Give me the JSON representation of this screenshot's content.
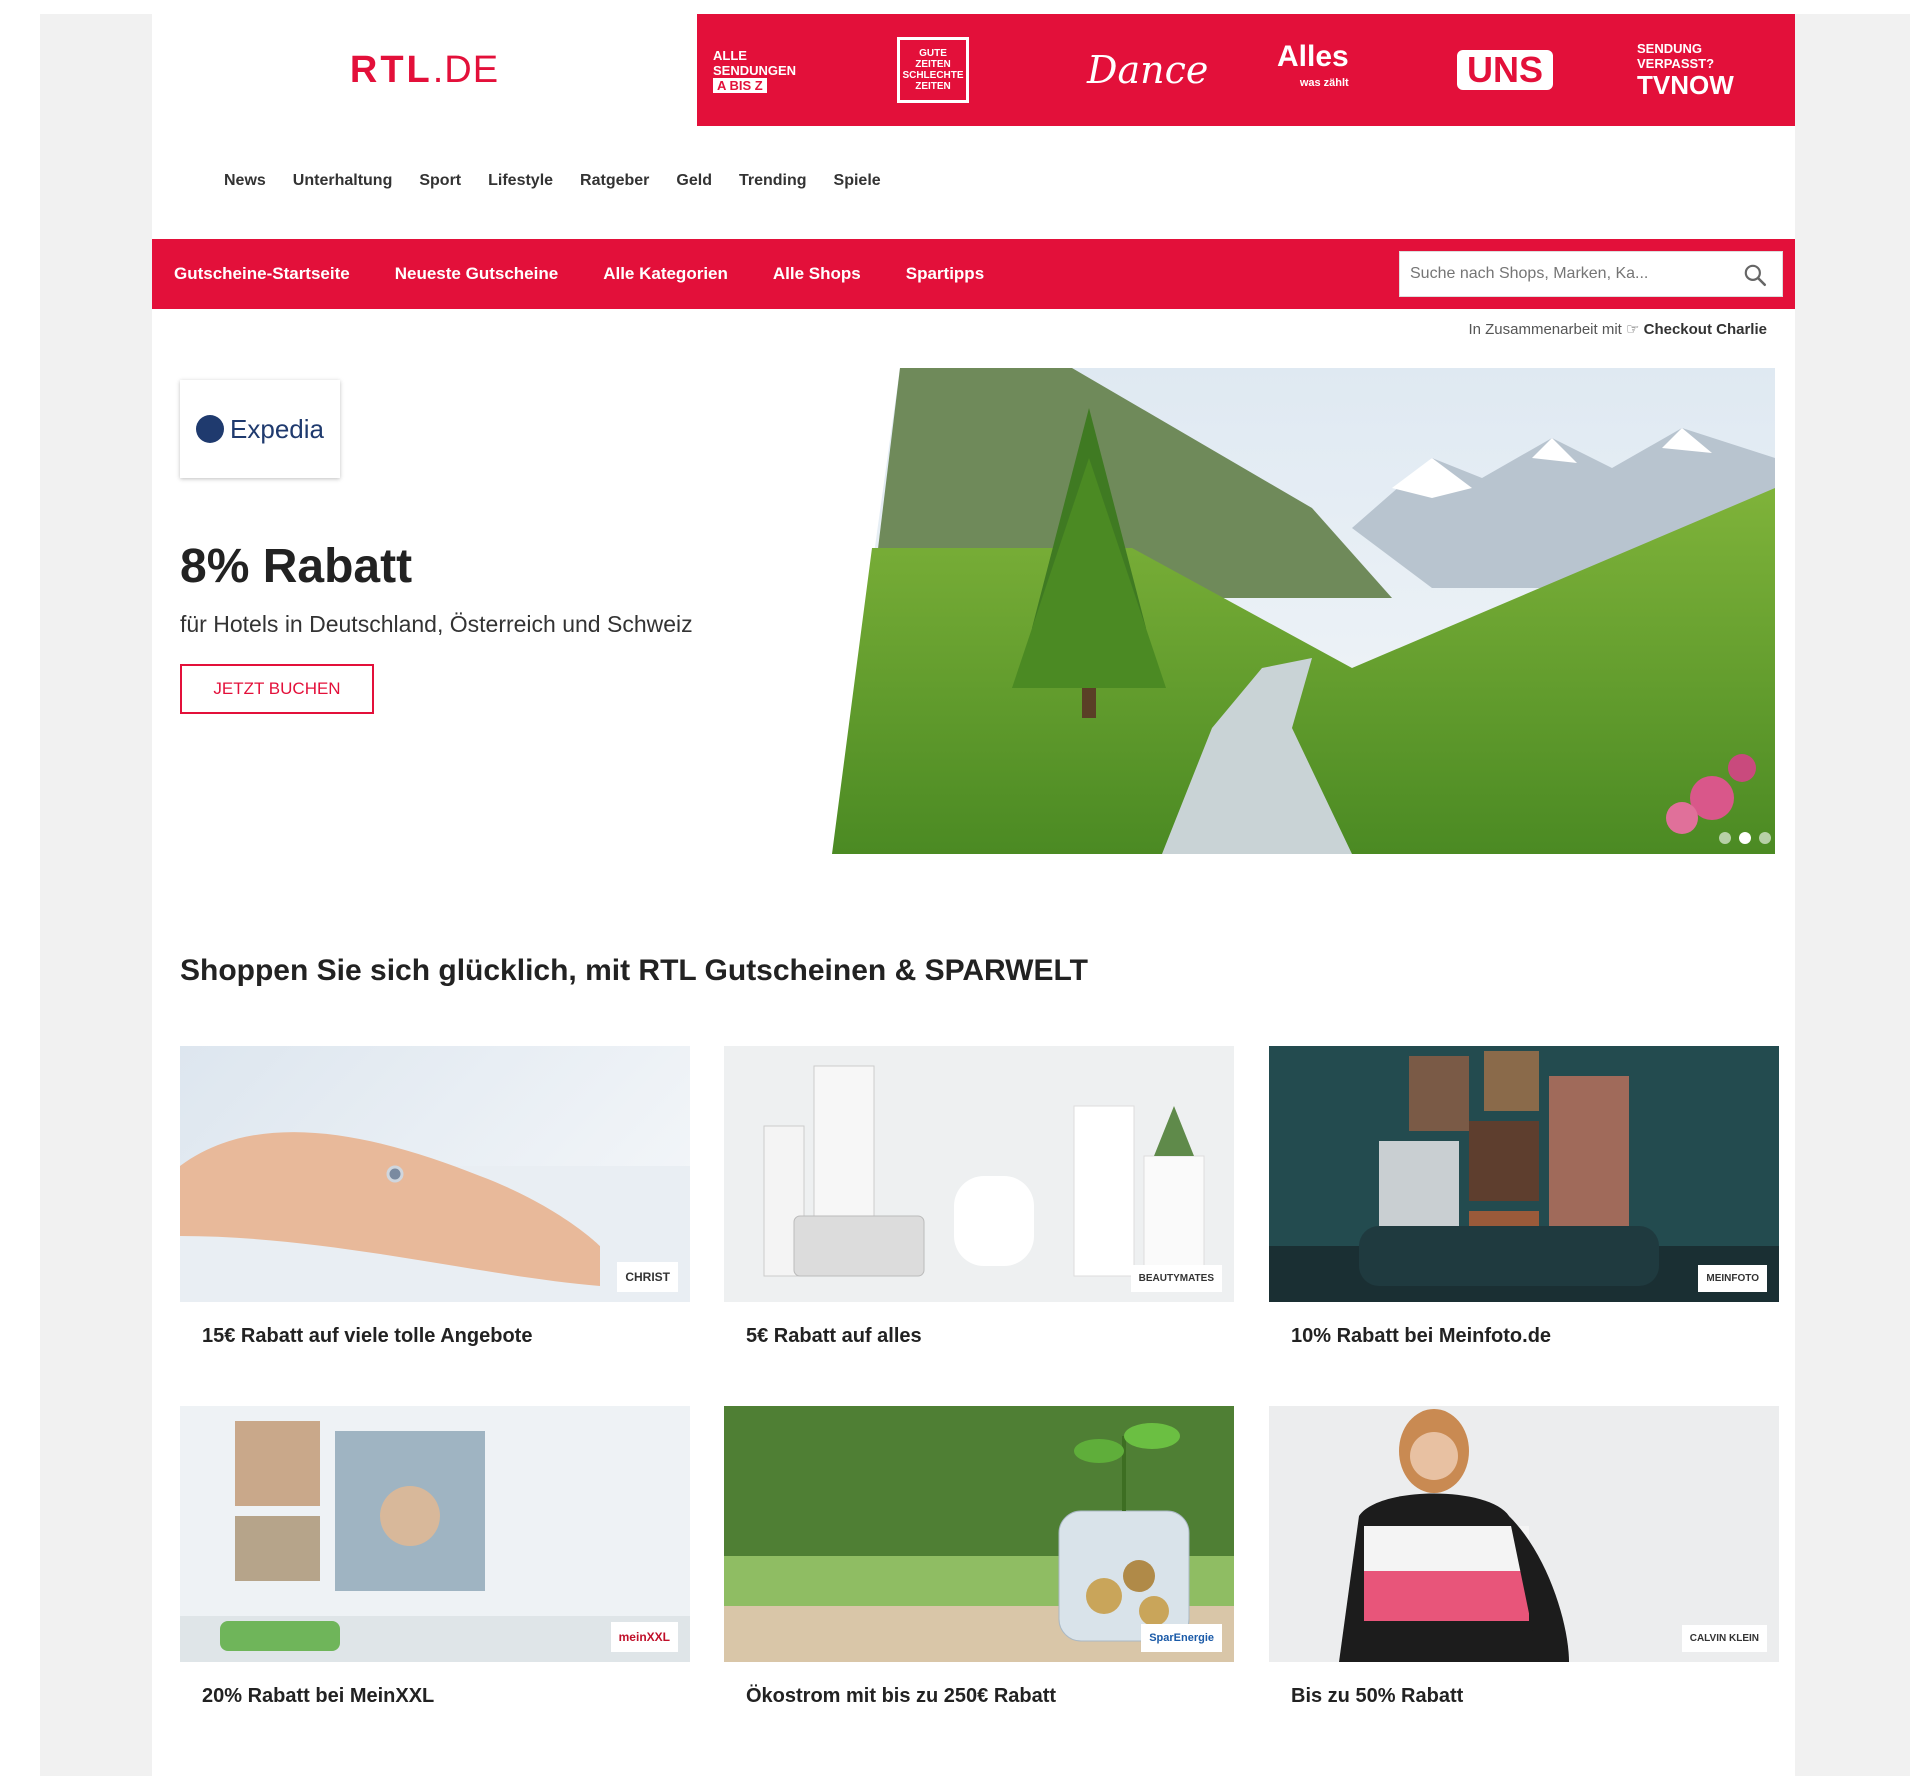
{
  "brand": {
    "logo_main": "RTL",
    "logo_suffix": ".DE"
  },
  "shows": {
    "alle_line1": "ALLE",
    "alle_line2": "SENDUNGEN",
    "alle_line3": "A BIS Z",
    "gzsz": "GUTE ZEITEN SCHLECHTE ZEITEN",
    "dance": "Dance",
    "alles": "Alles",
    "alles_sub": "was zählt",
    "uns": "UNS",
    "tvnow_line1": "SENDUNG",
    "tvnow_line2": "VERPASST?",
    "tvnow_logo": "TVNOW"
  },
  "main_nav": [
    "News",
    "Unterhaltung",
    "Sport",
    "Lifestyle",
    "Ratgeber",
    "Geld",
    "Trending",
    "Spiele"
  ],
  "coupon_nav": [
    "Gutscheine-Startseite",
    "Neueste Gutscheine",
    "Alle Kategorien",
    "Alle Shops",
    "Spartipps"
  ],
  "search": {
    "placeholder": "Suche nach Shops, Marken, Ka..."
  },
  "partner": {
    "prefix": "In Zusammenarbeit mit",
    "name": "Checkout Charlie"
  },
  "hero": {
    "brand": "Expedia",
    "title": "8% Rabatt",
    "subtitle": "für Hotels in Deutschland, Österreich und Schweiz",
    "button": "JETZT BUCHEN",
    "slides": 3,
    "active_slide": 2
  },
  "section_title": "Shoppen Sie sich glücklich, mit RTL Gutscheinen & SPARWELT",
  "cards": [
    {
      "caption": "15€ Rabatt auf viele tolle Angebote",
      "brand": "CHRIST"
    },
    {
      "caption": "5€ Rabatt auf alles",
      "brand": "BEAUTYMATES"
    },
    {
      "caption": "10% Rabatt bei Meinfoto.de",
      "brand": "MEINFOTO"
    },
    {
      "caption": "20% Rabatt bei MeinXXL",
      "brand": "meinXXL"
    },
    {
      "caption": "Ökostrom mit bis zu 250€ Rabatt",
      "brand": "SparEnergie"
    },
    {
      "caption": "Bis zu 50% Rabatt",
      "brand": "CALVIN KLEIN"
    }
  ],
  "colors": {
    "accent": "#e3103a",
    "background": "#f1f1f1"
  }
}
